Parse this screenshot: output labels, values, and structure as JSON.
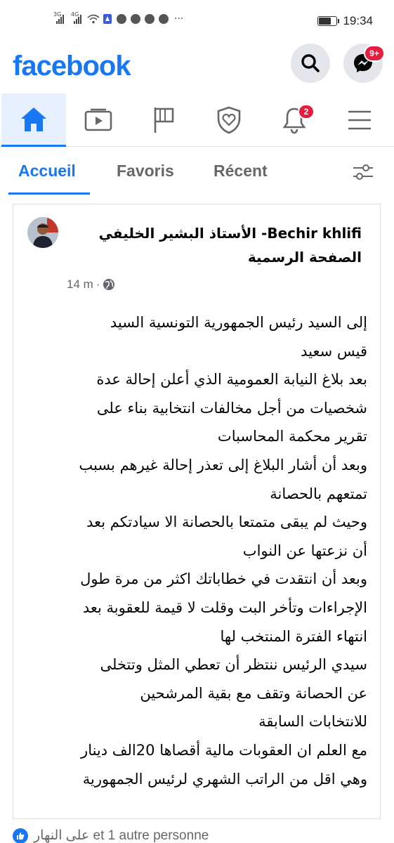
{
  "status_bar": {
    "sim1": "3G",
    "sim2": "4G",
    "time": "19:34"
  },
  "header": {
    "logo": "facebook",
    "messenger_badge": "9+"
  },
  "nav": {
    "items": [
      "home-icon",
      "watch-icon",
      "pages-icon",
      "dating-icon",
      "notifications-icon",
      "menu-icon"
    ],
    "notifications_badge": "2"
  },
  "tabs": {
    "items": [
      {
        "label": "Accueil",
        "active": true
      },
      {
        "label": "Favoris",
        "active": false
      },
      {
        "label": "Récent",
        "active": false
      }
    ]
  },
  "post": {
    "author": "Bechir khlifi- الأستاذ البشير الخليفي الصفحة الرسمية",
    "time": "14 m",
    "lines": [
      "إلى السيد رئيس  الجمهورية التونسية السيد",
      "قيس سعيد",
      "بعد بلاغ النيابة العمومية الذي أعلن إحالة عدة",
      "شخصيات من أجل مخالفات انتخابية بناء على",
      "تقرير محكمة المحاسبات",
      "وبعد أن أشار البلاغ إلى تعذر إحالة غيرهم بسبب",
      "تمتعهم  بالحصانة",
      "وحيث لم يبقى متمتعا بالحصانة الا سيادتكم بعد",
      "أن نزعتها  عن النواب",
      "وبعد أن انتقدت في خطاباتك  اكثر من مرة طول",
      "الإجراءات وتأخر البت وقلت لا قيمة للعقوبة بعد",
      "انتهاء الفترة المنتخب لها",
      "سيدي الرئيس  ننتظر أن تعطي المثل وتتخلى",
      "عن الحصانة وتقف مع بقية المرشحين",
      "للانتخابات السابقة",
      "مع العلم ان العقوبات مالية أقصاها 20الف دينار",
      "وهي اقل من الراتب الشهري لرئيس الجمهورية"
    ]
  },
  "reactions": {
    "text": "على النهار et 1 autre personne"
  },
  "colors": {
    "brand": "#1877f2",
    "badge": "#e41e3f"
  }
}
